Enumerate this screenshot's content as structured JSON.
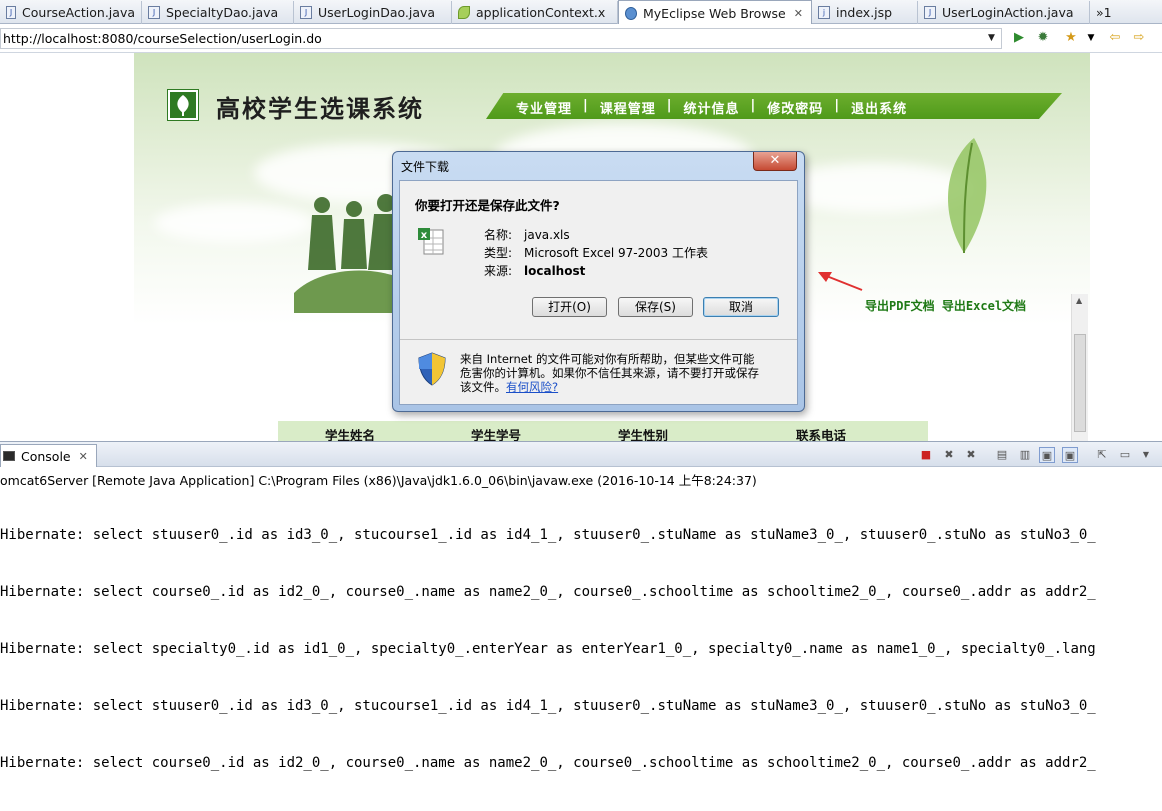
{
  "editor_tabs": [
    {
      "label": "CourseAction.java",
      "icon": "java-file-icon"
    },
    {
      "label": "SpecialtyDao.java",
      "icon": "java-file-icon"
    },
    {
      "label": "UserLoginDao.java",
      "icon": "java-file-icon"
    },
    {
      "label": "applicationContext.x",
      "icon": "spring-xml-icon"
    },
    {
      "label": "MyEclipse Web Browse",
      "icon": "globe-icon",
      "close": "✕"
    },
    {
      "label": "index.jsp",
      "icon": "jsp-file-icon"
    },
    {
      "label": "UserLoginAction.java",
      "icon": "java-file-icon"
    }
  ],
  "overflow_tabs": "»1",
  "browser": {
    "url": "http://localhost:8080/courseSelection/userLogin.do"
  },
  "site": {
    "title": "高校学生选课系统",
    "menu": [
      "专业管理",
      "课程管理",
      "统计信息",
      "修改密码",
      "退出系统"
    ],
    "menu_separator": "|",
    "export_pdf": "导出PDF文档",
    "export_excel": "导出Excel文档",
    "table_headers": [
      "学生姓名",
      "学生学号",
      "学生性别",
      "联系电话"
    ]
  },
  "dialog": {
    "title": "文件下载",
    "close": "✕",
    "question": "你要打开还是保存此文件?",
    "fields": [
      {
        "key": "名称:",
        "value": "java.xls"
      },
      {
        "key": "类型:",
        "value": "Microsoft Excel 97-2003 工作表"
      },
      {
        "key": "来源:",
        "value": "localhost"
      }
    ],
    "buttons": {
      "open": "打开(O)",
      "save": "保存(S)",
      "cancel": "取消"
    },
    "warning_line1": "来自 Internet 的文件可能对你有所帮助，但某些文件可能",
    "warning_line2": "危害你的计算机。如果你不信任其来源，请不要打开或保存",
    "warning_line3": "该文件。",
    "warning_link": "有何风险?"
  },
  "console": {
    "tab_label": "Console",
    "close": "✕",
    "info": "omcat6Server [Remote Java Application] C:\\Program Files (x86)\\Java\\jdk1.6.0_06\\bin\\javaw.exe (2016-10-14 上午8:24:37)",
    "lines": [
      "Hibernate: select stuuser0_.id as id3_0_, stucourse1_.id as id4_1_, stuuser0_.stuName as stuName3_0_, stuuser0_.stuNo as stuNo3_0_",
      "Hibernate: select course0_.id as id2_0_, course0_.name as name2_0_, course0_.schooltime as schooltime2_0_, course0_.addr as addr2_",
      "Hibernate: select specialty0_.id as id1_0_, specialty0_.enterYear as enterYear1_0_, specialty0_.name as name1_0_, specialty0_.lang",
      "Hibernate: select stuuser0_.id as id3_0_, stucourse1_.id as id4_1_, stuuser0_.stuName as stuName3_0_, stuuser0_.stuNo as stuNo3_0_",
      "Hibernate: select course0_.id as id2_0_, course0_.name as name2_0_, course0_.schooltime as schooltime2_0_, course0_.addr as addr2_"
    ]
  },
  "colors": {
    "menu_band": "#5aa323",
    "export_link": "#1f7a16",
    "annotation_arrow": "#e03030"
  }
}
